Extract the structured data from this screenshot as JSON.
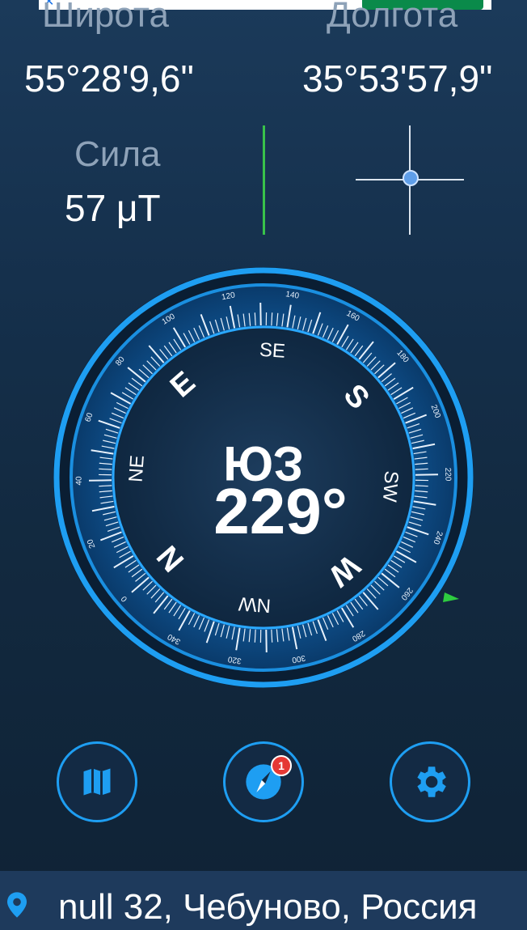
{
  "coordinates": {
    "latitude_label": "Широта",
    "latitude_value": "55°28'9,6\"",
    "longitude_label": "Долгота",
    "longitude_value": "35°53'57,9\""
  },
  "magnetic": {
    "force_label": "Сила",
    "force_value": "57 μT"
  },
  "compass": {
    "heading_direction": "ЮЗ",
    "heading_degrees": "229°",
    "cardinal_labels": [
      "N",
      "NE",
      "E",
      "SE",
      "S",
      "SW",
      "W",
      "NW"
    ],
    "tick_labels": [
      "0",
      "20",
      "40",
      "60",
      "80",
      "100",
      "120",
      "140",
      "160",
      "180",
      "200",
      "220",
      "240",
      "260",
      "280",
      "300",
      "320",
      "340"
    ],
    "accent_color": "#1e9ef2",
    "marker_color": "#2ecc40"
  },
  "toolbar": {
    "map_icon": "map-icon",
    "compass_icon": "compass-icon",
    "compass_badge": "1",
    "settings_icon": "gear-icon"
  },
  "footer": {
    "address": "null 32, Чебуново, Россия",
    "pin_icon": "location-pin-icon"
  },
  "colors": {
    "background": "#15304c",
    "label_gray": "#8ea2b8",
    "tilt_green": "#38c24a",
    "badge_red": "#e53935"
  }
}
